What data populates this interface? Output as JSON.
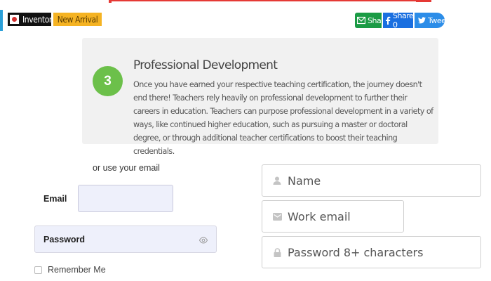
{
  "tags": {
    "inventory": "Inventory",
    "new_arrival": "New Arrival"
  },
  "share": {
    "share_label": "Share",
    "facebook_label": "Share 0",
    "tweet_label": "Tweet"
  },
  "card": {
    "step": "3",
    "title": "Professional Development",
    "body": "Once you have earned your respective teaching certification, the journey doesn't end there! Teachers rely heavily on professional development to further their careers in education. Teachers can purpose professional development in a variety of ways, like continued higher education, such as pursuing a master or doctoral degree, or through additional teacher certifications to boost their teaching credentials."
  },
  "login": {
    "or_email": "or use your email",
    "email_label": "Email",
    "email_value": "",
    "password_label": "Password",
    "remember_label": "Remember Me"
  },
  "signup": {
    "name_placeholder": "Name",
    "work_email_placeholder": "Work email",
    "password_placeholder": "Password 8+ characters"
  },
  "colors": {
    "step_green": "#6cc04a",
    "share_green": "#1b9b45",
    "facebook_blue": "#1a6fe0",
    "twitter_blue": "#2c8de8",
    "new_arrival_orange": "#f5b323",
    "accent_red": "#e53935"
  },
  "icons": {
    "flag": "flag-icon",
    "mail": "mail-icon",
    "facebook": "facebook-icon",
    "twitter": "twitter-icon",
    "eye": "eye-icon",
    "user": "user-icon",
    "envelope": "envelope-icon",
    "lock": "lock-icon"
  }
}
